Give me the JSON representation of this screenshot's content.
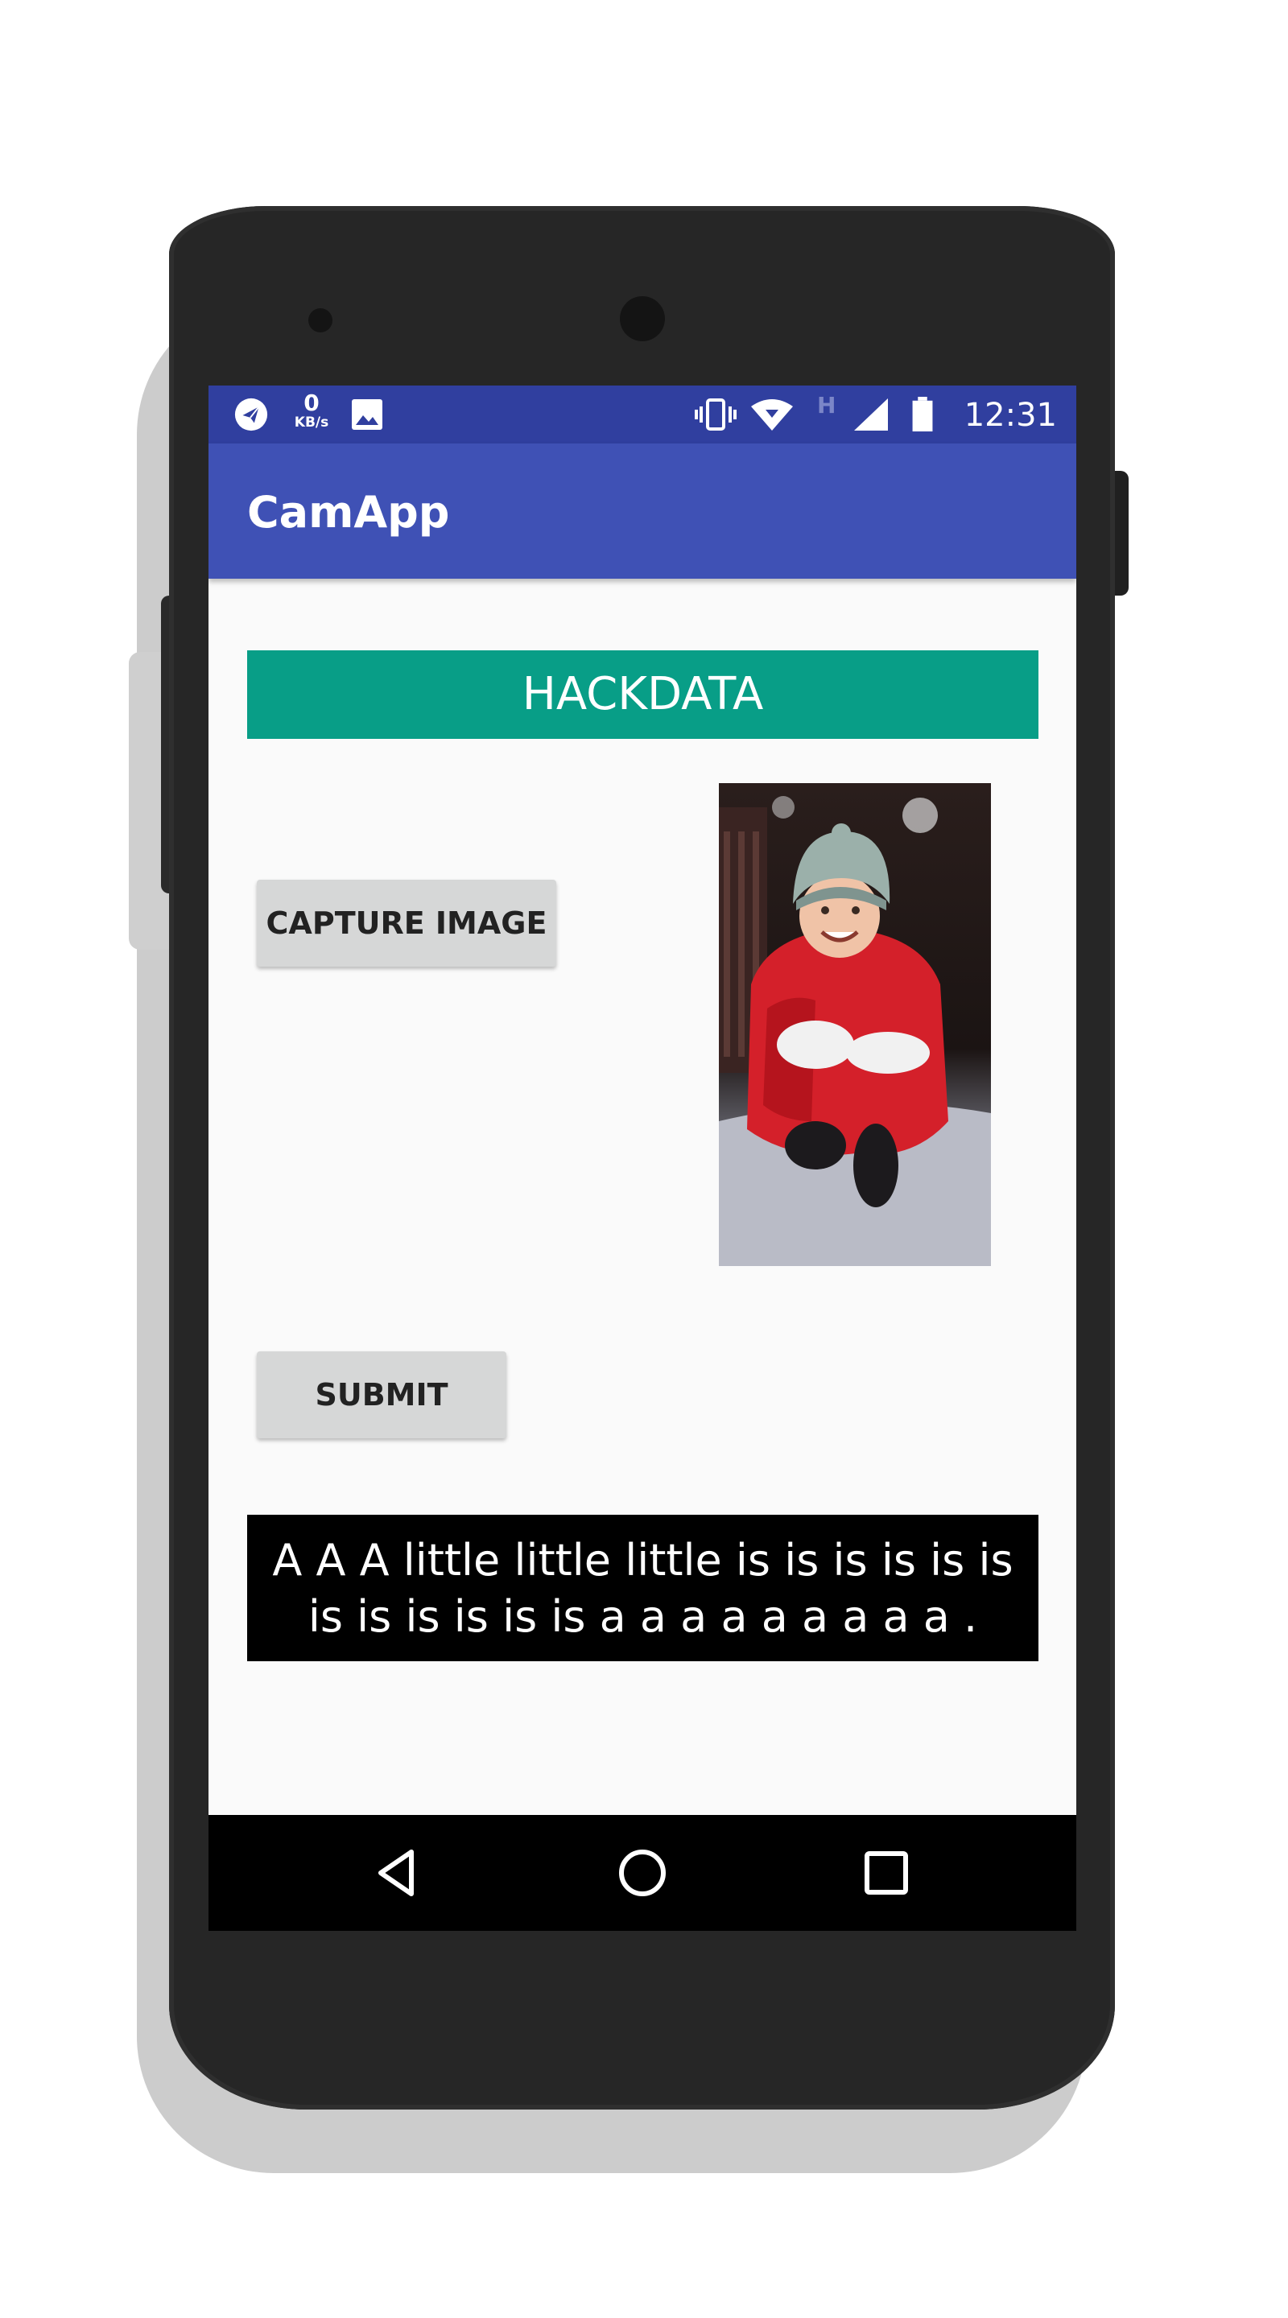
{
  "statusbar": {
    "net_speed_value": "0",
    "net_speed_unit": "KB/s",
    "network_type": "H",
    "time": "12:31",
    "icons": [
      "telegram-icon",
      "image-icon",
      "vibrate-icon",
      "wifi-icon",
      "signal-icon",
      "battery-icon"
    ]
  },
  "appbar": {
    "title": "CamApp"
  },
  "main": {
    "banner_text": "HACKDATA",
    "capture_label": "CAPTURE IMAGE",
    "submit_label": "SUBMIT",
    "caption_text": "A A A little little little is is is is is is is is is is is is a a a a a a a a a ."
  },
  "navbar": {
    "icons": [
      "back-icon",
      "home-icon",
      "recents-icon"
    ]
  },
  "colors": {
    "statusbar": "#303f9f",
    "appbar": "#3f51b5",
    "banner": "#089e87",
    "button": "#d6d7d7",
    "caption_bg": "#000000",
    "phone_body": "#262626"
  }
}
